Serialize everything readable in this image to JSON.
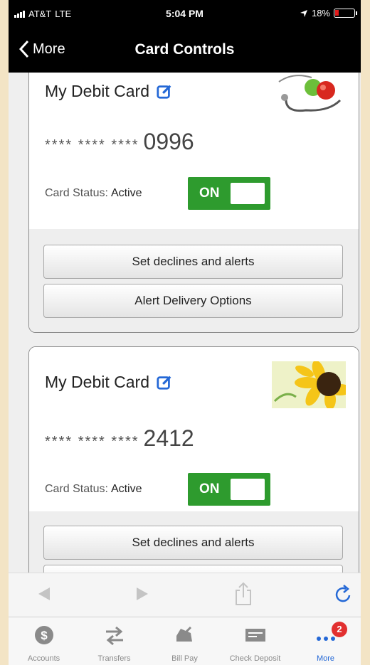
{
  "status_bar": {
    "carrier": "AT&T",
    "network": "LTE",
    "time": "5:04 PM",
    "battery": "18%"
  },
  "nav": {
    "back_label": "More",
    "title": "Card Controls"
  },
  "cards": [
    {
      "title": "My Debit Card",
      "mask": "**** **** ****",
      "last4": "0996",
      "status_label": "Card Status:",
      "status_value": "Active",
      "toggle_label": "ON",
      "thumbnail": "apple-stethoscope-image",
      "buttons": [
        "Set declines and alerts",
        "Alert Delivery Options"
      ]
    },
    {
      "title": "My Debit Card",
      "mask": "**** **** ****",
      "last4": "2412",
      "status_label": "Card Status:",
      "status_value": "Active",
      "toggle_label": "ON",
      "thumbnail": "sunflower-image",
      "buttons": [
        "Set declines and alerts"
      ]
    }
  ],
  "browser_bar": {
    "icons": [
      "back-arrow-icon",
      "forward-arrow-icon",
      "share-icon",
      "refresh-icon"
    ]
  },
  "tab_bar": {
    "tabs": [
      {
        "label": "Accounts",
        "icon": "dollar-icon"
      },
      {
        "label": "Transfers",
        "icon": "transfer-arrows-icon"
      },
      {
        "label": "Bill Pay",
        "icon": "bill-pay-icon"
      },
      {
        "label": "Check Deposit",
        "icon": "check-icon"
      },
      {
        "label": "More",
        "icon": "more-dots-icon",
        "badge": "2"
      }
    ]
  },
  "colors": {
    "toggle_on": "#2e9b2e",
    "accent": "#2468d6",
    "badge": "#e23030"
  }
}
